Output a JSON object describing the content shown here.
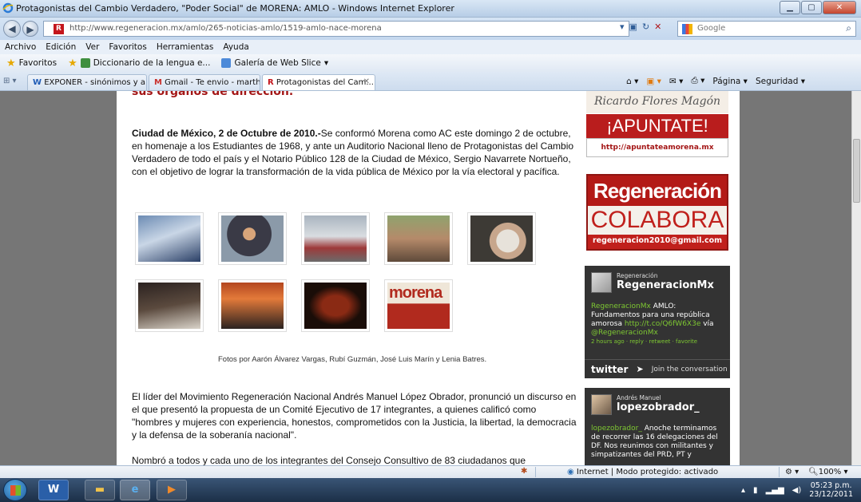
{
  "window": {
    "title": "Protagonistas del Cambio Verdadero, \"Poder Social\" de MORENA: AMLO - Windows Internet Explorer"
  },
  "addressbar": {
    "url": "http://www.regeneracion.mx/amlo/265-noticias-amlo/1519-amlo-nace-morena",
    "search_placeholder": "Google"
  },
  "menu": [
    "Archivo",
    "Edición",
    "Ver",
    "Favoritos",
    "Herramientas",
    "Ayuda"
  ],
  "favorites": {
    "label": "Favoritos",
    "items": [
      "Diccionario de la lengua e...",
      "Galería de Web Slice"
    ]
  },
  "tabs": [
    "EXPONER - sinónimos y a...",
    "Gmail - Te envio - marthar...",
    "Protagonistas del Cam..."
  ],
  "commandbar": {
    "page": "Página",
    "security": "Seguridad"
  },
  "article": {
    "cut_heading": "sus órganos de dirección.",
    "lead_bold": "Ciudad de México, 2 de Octubre de 2010.-",
    "lead_text": "Se conformó Morena como AC este domingo 2 de octubre, en homenaje a los Estudiantes de 1968, y ante un Auditorio Nacional lleno de Protagonistas del Cambio Verdadero de todo el país y el Notario Público 128 de la Ciudad de México, Sergio Navarrete Nortueño, con el objetivo de lograr la transformación de la vida pública de México por la vía electoral y pacífica.",
    "photo_caption": "Fotos por Aarón Álvarez Vargas, Rubí Guzmán, José Luis Marín y Lenia Batres.",
    "photo_labels": [
      "morena"
    ],
    "para2": "El líder del Movimiento Regeneración Nacional Andrés Manuel López Obrador, pronunció un discurso en el que presentó la propuesta de un Comité Ejecutivo de 17 integrantes, a quienes calificó como \"hombres y mujeres con experiencia, honestos, comprometidos con la Justicia, la libertad, la democracia y la defensa de la soberanía nacional\".",
    "para3": "Nombró a todos y cada uno de los integrantes del Consejo Consultivo de 83 ciudadanos que"
  },
  "sidebar": {
    "magon": "Ricardo Flores Magón",
    "apuntate": "¡APUNTATE!",
    "apuntate_url": "http://apuntateamorena.mx",
    "regeneracion": "Regeneración",
    "colabora": "COLABORA",
    "email": "regeneracion2010@gmail.com",
    "widget1": {
      "small": "Regeneración",
      "handle": "RegeneracionMx",
      "user": "RegeneracionMx",
      "text": " AMLO: Fundamentos para una república amorosa ",
      "link": "http://t.co/Q6fW6X3e",
      "via": " vía ",
      "via_user": "@RegeneracionMx",
      "meta": "2 hours ago · reply · retweet · favorite",
      "logo": "twitter",
      "join": "Join the conversation"
    },
    "widget2": {
      "small": "Andrés Manuel",
      "handle": "lopezobrador_",
      "user": "lopezobrador_",
      "text": "  Anoche terminamos de recorrer las 16 delegaciones del DF. Nos reunimos con militantes y simpatizantes del PRD, PT y"
    }
  },
  "status": {
    "zone": "Internet | Modo protegido: activado",
    "zoom": "100%"
  },
  "taskbar": {
    "time": "05:23 p.m.",
    "date": "23/12/2011"
  },
  "colors": {
    "brand_red": "#b91d1d",
    "twitter_green": "#7ec832",
    "widget_bg": "#333333"
  }
}
